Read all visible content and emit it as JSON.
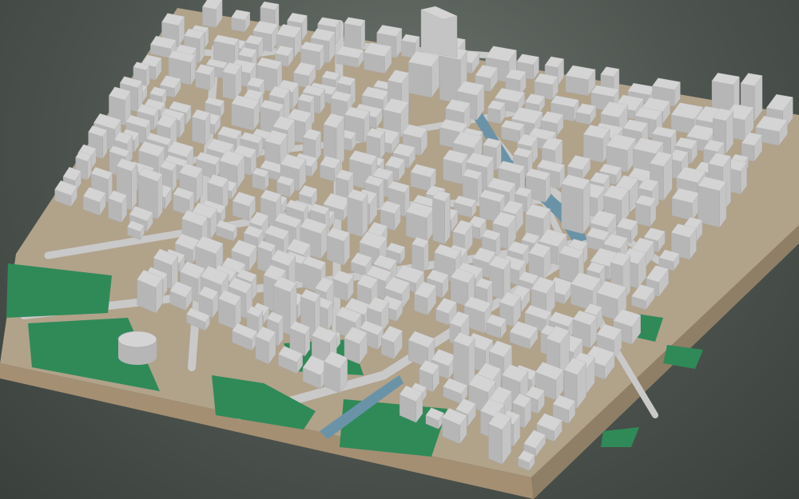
{
  "viewer": {
    "background_color": "#4d544f"
  },
  "model": {
    "ground_color": "#b1a28a",
    "base_side_color": "#8f7f66",
    "base_front_color": "#a48f72",
    "building_top_color": "#d4d4d4",
    "building_left_color": "#b6b6b6",
    "building_right_color": "#c4c4c4",
    "park_color": "#2f8a58",
    "water_color": "#6a93a8",
    "road_color": "#c9c9c9"
  }
}
